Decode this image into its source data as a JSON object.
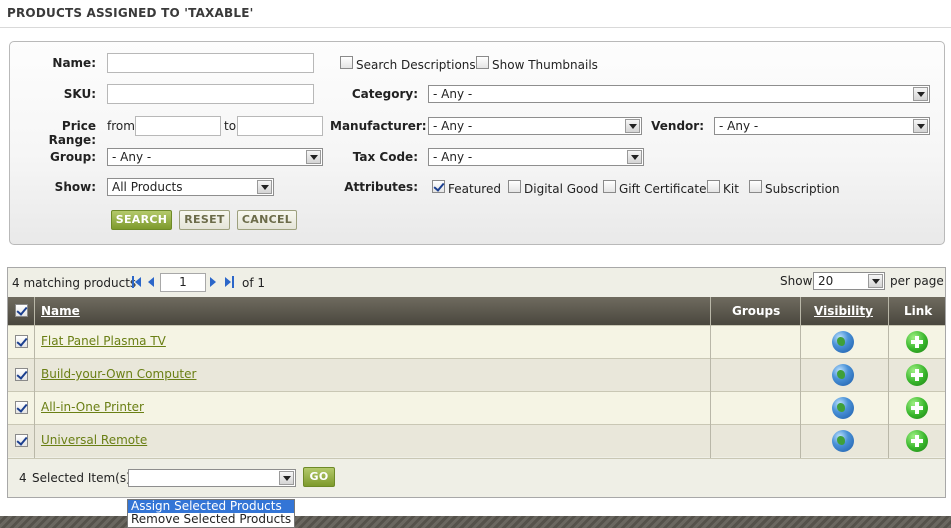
{
  "page": {
    "title": "PRODUCTS ASSIGNED TO 'TAXABLE'"
  },
  "search": {
    "name_label": "Name:",
    "name_value": "",
    "sku_label": "SKU:",
    "sku_value": "",
    "price_label": "Price Range:",
    "price_from": "from",
    "price_to": "to",
    "group_label": "Group:",
    "group_value": "- Any -",
    "show_label": "Show:",
    "show_value": "All Products",
    "search_descriptions": "Search Descriptions",
    "show_thumbnails": "Show Thumbnails",
    "category_label": "Category:",
    "category_value": "- Any -",
    "manufacturer_label": "Manufacturer:",
    "manufacturer_value": "- Any -",
    "vendor_label": "Vendor:",
    "vendor_value": "- Any -",
    "taxcode_label": "Tax Code:",
    "taxcode_value": "- Any -",
    "attributes_label": "Attributes:",
    "attributes": [
      {
        "label": "Featured",
        "checked": true
      },
      {
        "label": "Digital Good",
        "checked": false
      },
      {
        "label": "Gift Certificate",
        "checked": false
      },
      {
        "label": "Kit",
        "checked": false
      },
      {
        "label": "Subscription",
        "checked": false
      }
    ],
    "search_button": "SEARCH",
    "reset_button": "RESET",
    "cancel_button": "CANCEL"
  },
  "results": {
    "count_text": "4 matching products",
    "page_value": "1",
    "page_of": "of 1",
    "show_label": "Show",
    "per_page_value": "20",
    "per_page_label": "per page",
    "columns": {
      "name": "Name",
      "groups": "Groups",
      "visibility": "Visibility",
      "link": "Link"
    },
    "rows": [
      {
        "name": "Flat Panel Plasma TV",
        "groups": "",
        "checked": true
      },
      {
        "name": "Build-your-Own Computer",
        "groups": "",
        "checked": true
      },
      {
        "name": "All-in-One Printer",
        "groups": "",
        "checked": true
      },
      {
        "name": "Universal Remote",
        "groups": "",
        "checked": true
      }
    ],
    "selected_count": "4",
    "selected_label": "Selected Item(s):",
    "action_value": "",
    "go_button": "GO",
    "action_options": [
      "Assign Selected Products",
      "Remove Selected Products"
    ]
  },
  "colors": {
    "accent_green": "#7d9a2c",
    "link_olive": "#6a7f14",
    "header_dark": "#4a473e",
    "highlight_blue": "#3375d6"
  },
  "icons": {
    "visibility": "globe-icon",
    "link": "add-circle-icon"
  }
}
